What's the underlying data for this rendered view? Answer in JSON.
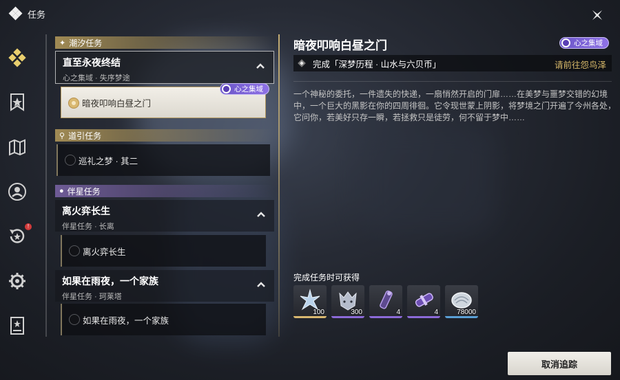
{
  "header": {
    "title": "任务"
  },
  "sidebar": {
    "badge": "!"
  },
  "tasklist": {
    "categories": [
      {
        "label": "潮汐任务"
      },
      {
        "label": "道引任务"
      },
      {
        "label": "伴星任务"
      }
    ],
    "groups": [
      {
        "name": "直至永夜终结",
        "sub": "心之集域 · 失序梦途"
      },
      {
        "name": "离火弈长生",
        "sub": "伴星任务 · 长离"
      },
      {
        "name": "如果在雨夜，一个家族",
        "sub": "伴星任务 · 珂莱塔"
      }
    ],
    "tasks": [
      {
        "label": "暗夜叩响白昼之门",
        "tag": "心之集域"
      },
      {
        "label": "巡礼之梦 · 其二"
      },
      {
        "label": "离火弈长生"
      },
      {
        "label": "如果在雨夜，一个家族"
      }
    ]
  },
  "detail": {
    "title": "暗夜叩响白昼之门",
    "tag": "心之集域",
    "objective": "完成「深梦历程 · 山水与六贝币」",
    "navigate": "请前往怨鸟泽",
    "description": "一个神秘的委托，一件遗失的快递，一扇悄然开启的门扉……在美梦与噩梦交错的幻境中，一个巨大的黑影在你的四周徘徊。它令现世蒙上阴影，将梦境之门开遍了今州各处，它问你，若美好只存一瞬，若拯救只是徒劳，何不留于梦中……",
    "rewards_label": "完成任务时可获得",
    "rewards": [
      {
        "count": "100",
        "icon": "star-crystal-icon",
        "rarity": "#d9b870"
      },
      {
        "count": "300",
        "icon": "wolf-exp-icon",
        "rarity": "#8c6ad8"
      },
      {
        "count": "4",
        "icon": "tube-material-icon",
        "rarity": "#8c6ad8"
      },
      {
        "count": "4",
        "icon": "capsule-material-icon",
        "rarity": "#8c6ad8"
      },
      {
        "count": "78000",
        "icon": "shell-credit-icon",
        "rarity": "#5aa0d6"
      }
    ],
    "cancel_label": "取消追踪"
  }
}
